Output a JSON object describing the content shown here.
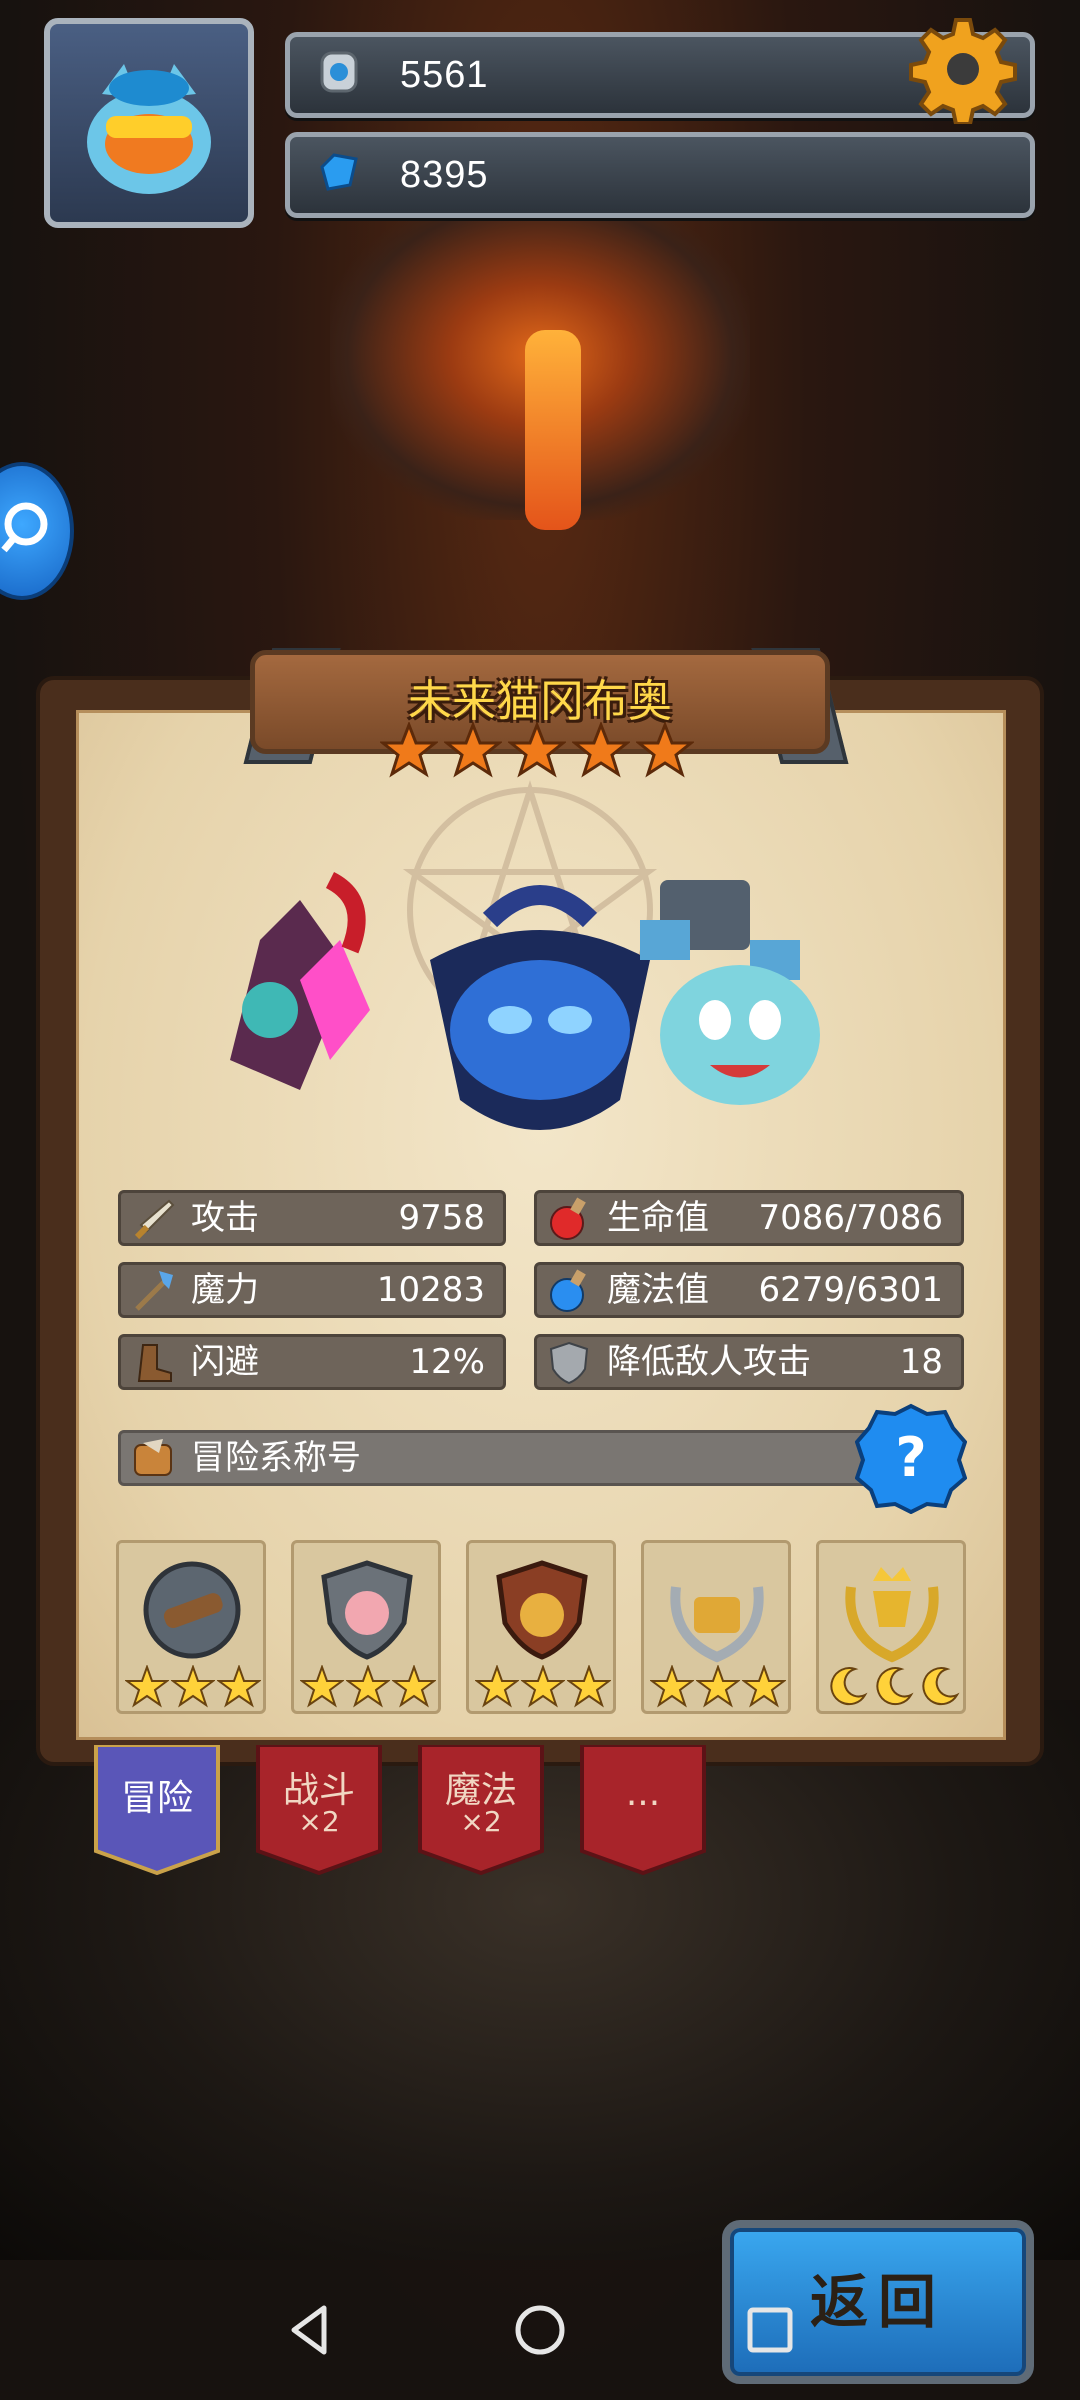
{
  "resources": {
    "coins": "5561",
    "gems": "8395"
  },
  "hero": {
    "name": "未来猫冈布奥",
    "stars": 5
  },
  "stats": [
    {
      "icon": "sword-icon",
      "label": "攻击",
      "value": "9758"
    },
    {
      "icon": "health-potion-icon",
      "label": "生命值",
      "value": "7086/7086"
    },
    {
      "icon": "magic-staff-icon",
      "label": "魔力",
      "value": "10283"
    },
    {
      "icon": "mana-potion-icon",
      "label": "魔法值",
      "value": "6279/6301"
    },
    {
      "icon": "boot-icon",
      "label": "闪避",
      "value": "12%"
    },
    {
      "icon": "shield-icon",
      "label": "降低敌人攻击",
      "value": "18"
    }
  ],
  "title_bar": {
    "icon": "scroll-icon",
    "label": "冒险系称号"
  },
  "medals": [
    {
      "name": "telescope-medal",
      "stars": 3
    },
    {
      "name": "pig-shield-medal",
      "stars": 3
    },
    {
      "name": "money-bag-medal",
      "stars": 3
    },
    {
      "name": "treasure-laurel-medal",
      "stars": 3
    },
    {
      "name": "golden-crown-trophy-medal",
      "stars": 3,
      "star_style": "moon"
    }
  ],
  "tabs": [
    {
      "label": "冒险",
      "sub": "",
      "active": true
    },
    {
      "label": "战斗",
      "sub": "×2",
      "active": false
    },
    {
      "label": "魔法",
      "sub": "×2",
      "active": false
    },
    {
      "label": "...",
      "sub": "",
      "active": false
    }
  ],
  "back_button": {
    "label": "返回"
  },
  "colors": {
    "gold": "#ffd84a",
    "panel": "#efe0c0",
    "tab_red": "#a8242a",
    "tab_blue": "#5a56b8",
    "accent_blue": "#2f8ee8"
  }
}
